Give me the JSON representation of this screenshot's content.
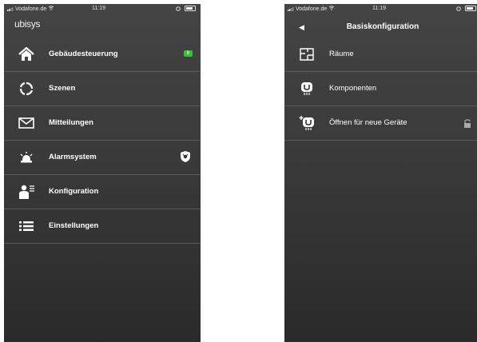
{
  "left_phone": {
    "status": {
      "carrier": "Vodafone.de",
      "time": "11:19"
    },
    "logo": "ubisys",
    "menu": [
      {
        "label": "Gebäudesteuerung",
        "icon": "house-icon",
        "badge": "8"
      },
      {
        "label": "Szenen",
        "icon": "scene-icon"
      },
      {
        "label": "Mitteilungen",
        "icon": "envelope-icon"
      },
      {
        "label": "Alarmsystem",
        "icon": "alarm-icon",
        "trailing_icon": "shield-icon"
      },
      {
        "label": "Konfiguration",
        "icon": "user-config-icon"
      },
      {
        "label": "Einstellungen",
        "icon": "list-icon"
      }
    ],
    "badge_color": "#35c22f"
  },
  "right_phone": {
    "status": {
      "carrier": "Vodafone.de",
      "time": "11:19"
    },
    "title": "Basiskonfiguration",
    "back_icon": "back-arrow-icon",
    "menu": [
      {
        "label": "Räume",
        "icon": "floorplan-icon"
      },
      {
        "label": "Komponenten",
        "icon": "device-icon"
      },
      {
        "label": "Öffnen für neue Geräte",
        "icon": "add-device-icon",
        "trailing_icon": "lock-open-icon"
      }
    ]
  }
}
